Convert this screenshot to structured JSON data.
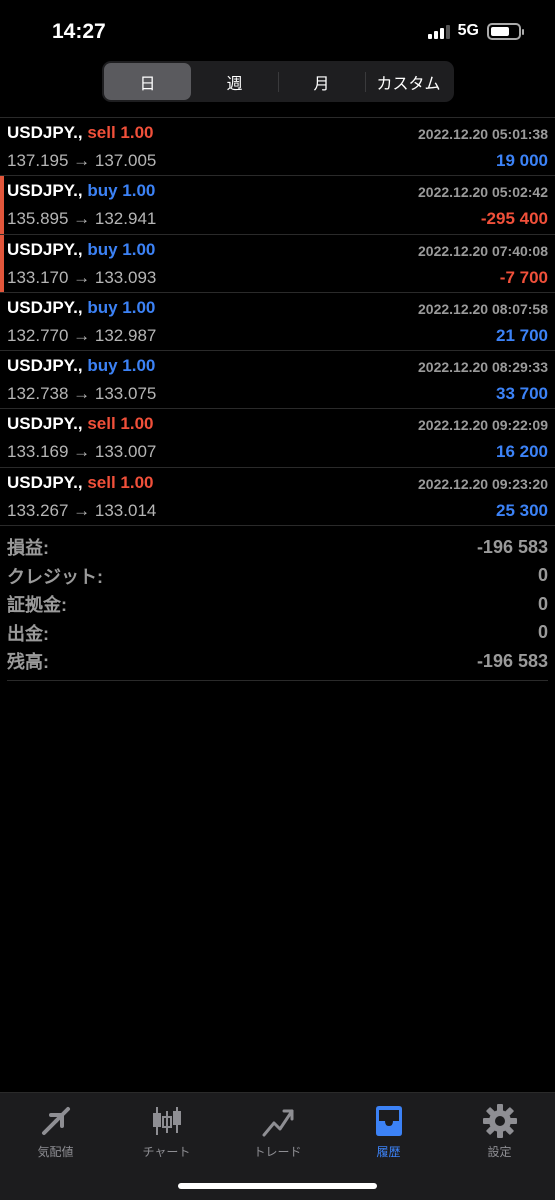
{
  "status": {
    "time": "14:27",
    "network": "5G"
  },
  "period_tabs": [
    {
      "label": "日",
      "active": true
    },
    {
      "label": "週",
      "active": false
    },
    {
      "label": "月",
      "active": false
    },
    {
      "label": "カスタム",
      "active": false
    }
  ],
  "deals": [
    {
      "symbol": "USDJPY.,",
      "type": "sell",
      "volume": "1.00",
      "time": "2022.12.20 05:01:38",
      "prices": "137.195 → 137.005",
      "profit": "19 000",
      "profit_sign": "pos"
    },
    {
      "symbol": "USDJPY.,",
      "type": "buy",
      "volume": "1.00",
      "time": "2022.12.20 05:02:42",
      "prices": "135.895 → 132.941",
      "profit": "-295 400",
      "profit_sign": "neg"
    },
    {
      "symbol": "USDJPY.,",
      "type": "buy",
      "volume": "1.00",
      "time": "2022.12.20 07:40:08",
      "prices": "133.170 → 133.093",
      "profit": "-7 700",
      "profit_sign": "neg"
    },
    {
      "symbol": "USDJPY.,",
      "type": "buy",
      "volume": "1.00",
      "time": "2022.12.20 08:07:58",
      "prices": "132.770 → 132.987",
      "profit": "21 700",
      "profit_sign": "pos"
    },
    {
      "symbol": "USDJPY.,",
      "type": "buy",
      "volume": "1.00",
      "time": "2022.12.20 08:29:33",
      "prices": "132.738 → 133.075",
      "profit": "33 700",
      "profit_sign": "pos"
    },
    {
      "symbol": "USDJPY.,",
      "type": "sell",
      "volume": "1.00",
      "time": "2022.12.20 09:22:09",
      "prices": "133.169 → 133.007",
      "profit": "16 200",
      "profit_sign": "pos"
    },
    {
      "symbol": "USDJPY.,",
      "type": "sell",
      "volume": "1.00",
      "time": "2022.12.20 09:23:20",
      "prices": "133.267 → 133.014",
      "profit": "25 300",
      "profit_sign": "pos"
    }
  ],
  "summary": [
    {
      "label": "損益:",
      "value": "-196 583"
    },
    {
      "label": "クレジット:",
      "value": "0"
    },
    {
      "label": "証拠金:",
      "value": "0"
    },
    {
      "label": "出金:",
      "value": "0"
    },
    {
      "label": "残高:",
      "value": "-196 583"
    }
  ],
  "tab_bar": [
    {
      "label": "気配値",
      "icon": "quotes-arrows-icon",
      "active": false
    },
    {
      "label": "チャート",
      "icon": "candlestick-icon",
      "active": false
    },
    {
      "label": "トレード",
      "icon": "trade-line-icon",
      "active": false
    },
    {
      "label": "履歴",
      "icon": "inbox-tray-icon",
      "active": true
    },
    {
      "label": "設定",
      "icon": "gear-icon",
      "active": false
    }
  ],
  "colors": {
    "sell": "#f0503a",
    "buy": "#3c82f6",
    "profit_pos": "#3c82f6",
    "profit_neg": "#f0503a",
    "tab_active": "#3c82f6",
    "tab_inactive": "#8e8e93"
  }
}
